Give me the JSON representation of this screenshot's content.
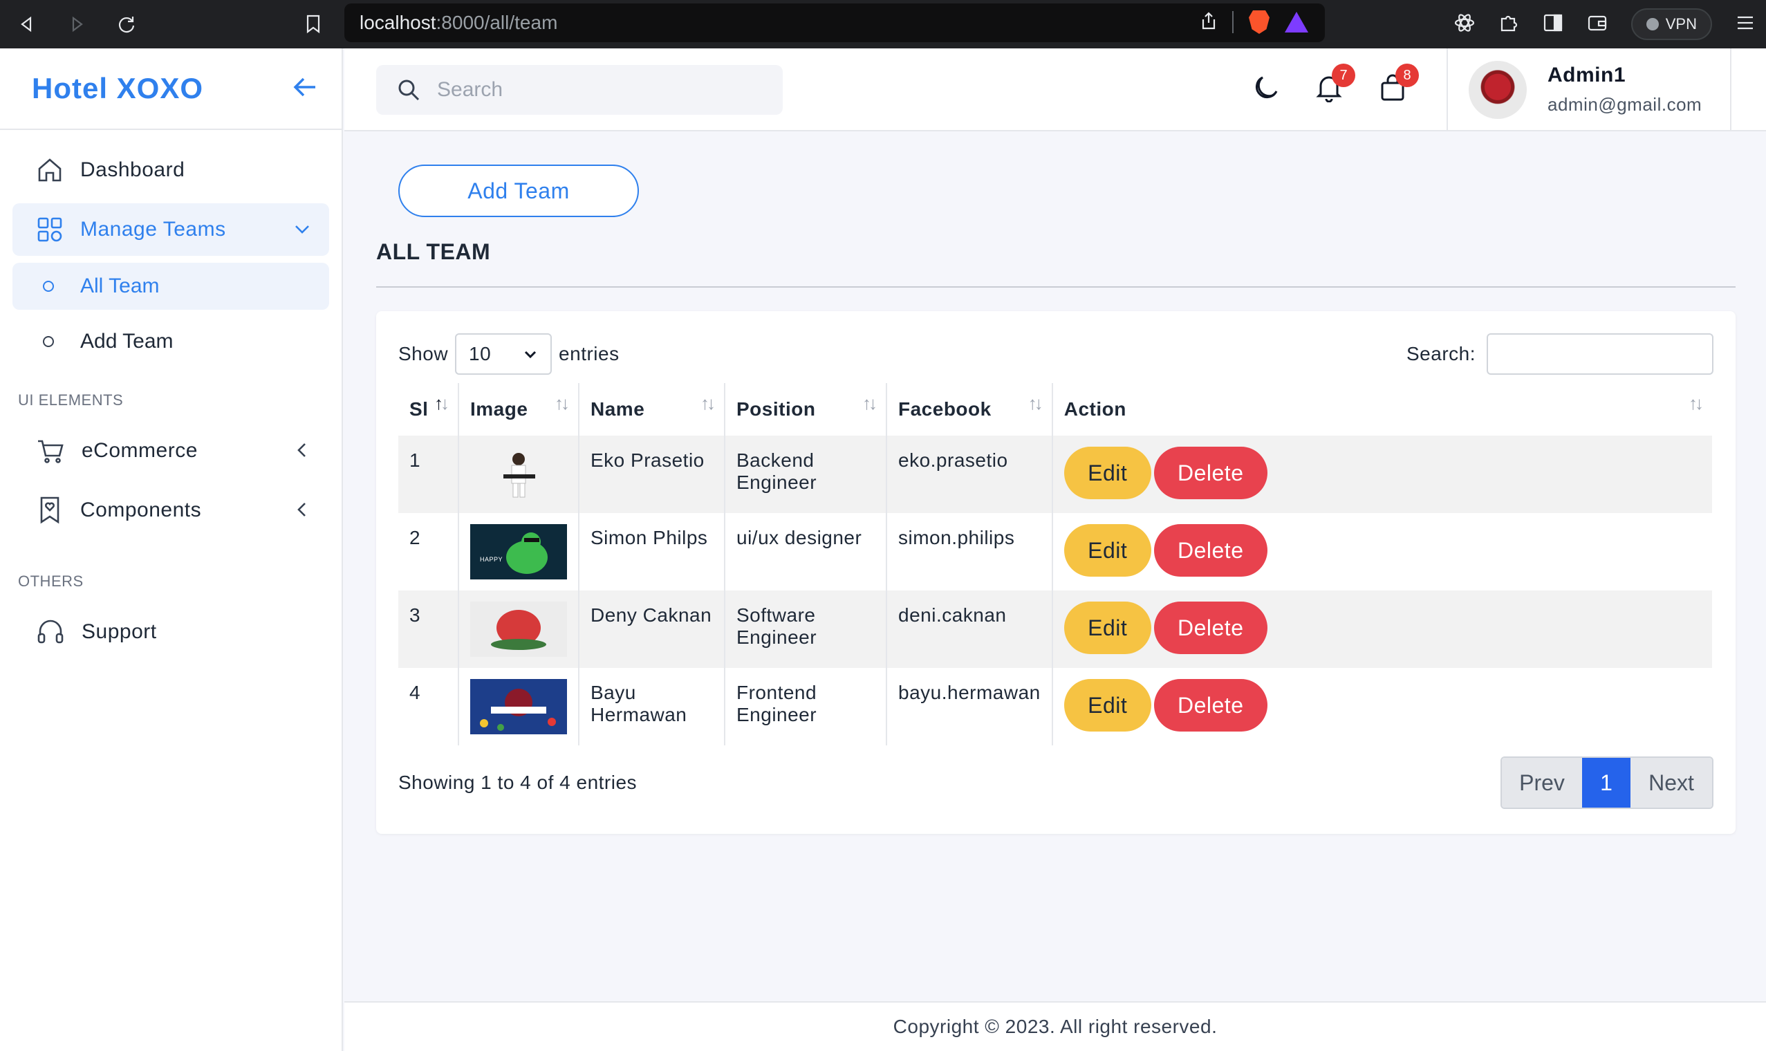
{
  "browser": {
    "url_host": "localhost",
    "url_path": ":8000/all/team",
    "vpn_label": "VPN"
  },
  "sidebar": {
    "brand": "Hotel XOXO",
    "items": [
      {
        "label": "Dashboard",
        "icon": "home-icon"
      },
      {
        "label": "Manage Teams",
        "icon": "grid-icon"
      }
    ],
    "sub_items": [
      {
        "label": "All Team"
      },
      {
        "label": "Add Team"
      }
    ],
    "section_ui": "UI ELEMENTS",
    "ui_items": [
      {
        "label": "eCommerce",
        "icon": "cart-icon"
      },
      {
        "label": "Components",
        "icon": "bookmark-heart-icon"
      }
    ],
    "section_others": "OTHERS",
    "others_items": [
      {
        "label": "Support",
        "icon": "headset-icon"
      }
    ]
  },
  "header": {
    "search_placeholder": "Search",
    "notifications_count": "7",
    "cart_count": "8",
    "user_name": "Admin1",
    "user_email": "admin@gmail.com"
  },
  "main": {
    "add_button": "Add Team",
    "title": "ALL TEAM",
    "show_label": "Show",
    "entries_value": "10",
    "entries_label": "entries",
    "search_label": "Search:",
    "columns": [
      "Sl",
      "Image",
      "Name",
      "Position",
      "Facebook",
      "Action"
    ],
    "rows": [
      {
        "sl": "1",
        "name": "Eko Prasetio",
        "position": "Backend Engineer",
        "facebook": "eko.prasetio"
      },
      {
        "sl": "2",
        "name": "Simon Philps",
        "position": "ui/ux designer",
        "facebook": "simon.philips"
      },
      {
        "sl": "3",
        "name": "Deny Caknan",
        "position": "Software Engineer",
        "facebook": "deni.caknan"
      },
      {
        "sl": "4",
        "name": "Bayu Hermawan",
        "position": "Frontend Engineer",
        "facebook": "bayu.hermawan"
      }
    ],
    "edit_label": "Edit",
    "delete_label": "Delete",
    "info": "Showing 1 to 4 of 4 entries",
    "pager": {
      "prev": "Prev",
      "current": "1",
      "next": "Next"
    }
  },
  "footer": "Copyright © 2023. All right reserved.",
  "colors": {
    "accent": "#2f80ed",
    "edit": "#f6c343",
    "delete": "#e8424e",
    "page_active": "#2563eb"
  }
}
